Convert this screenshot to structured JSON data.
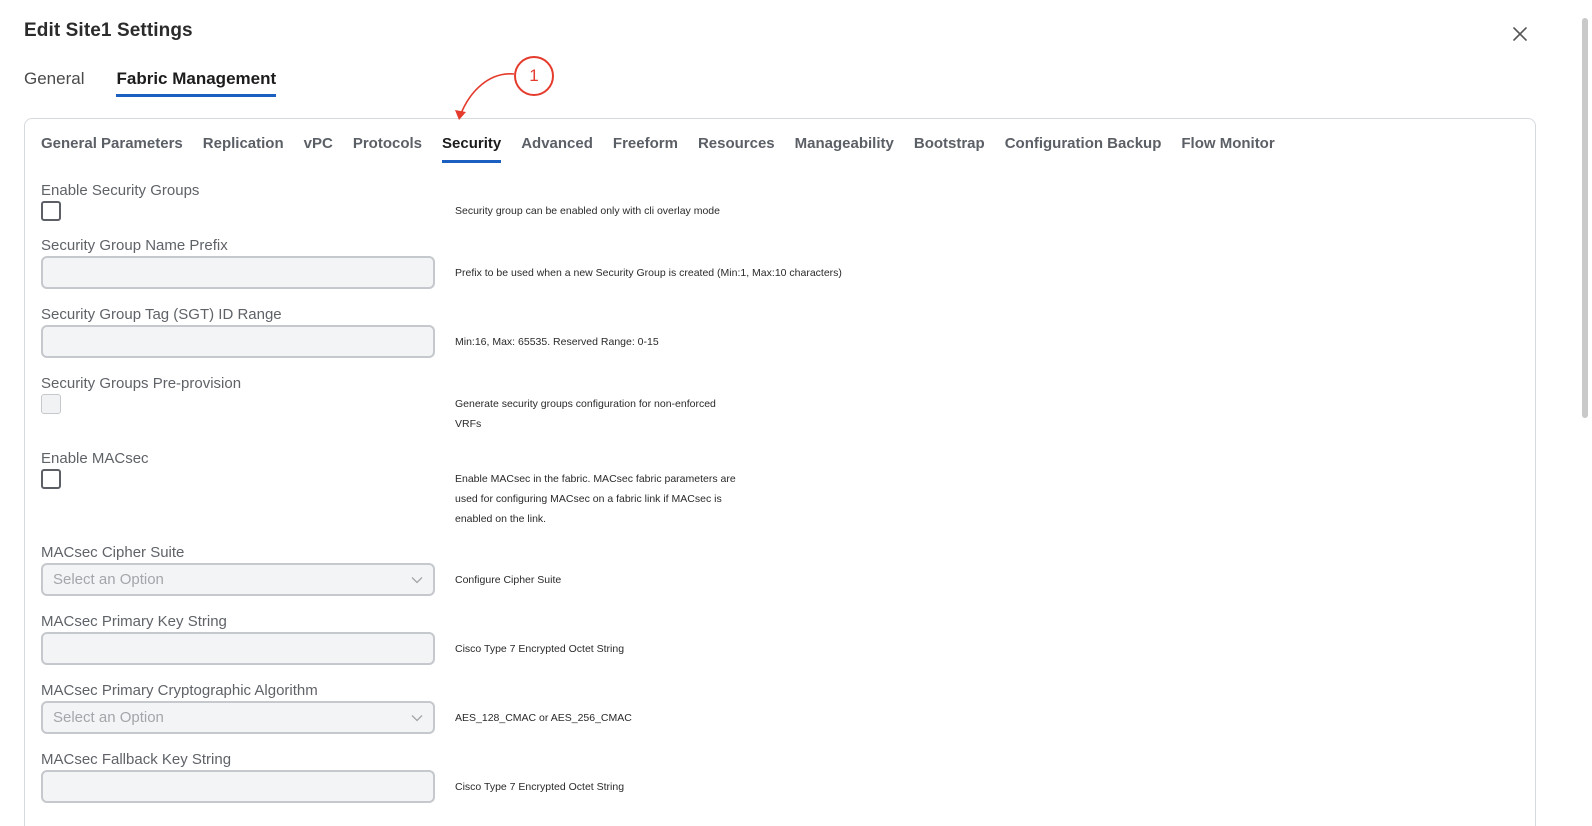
{
  "dialog": {
    "title": "Edit Site1 Settings"
  },
  "top_tabs": [
    {
      "label": "General",
      "active": false
    },
    {
      "label": "Fabric Management",
      "active": true
    }
  ],
  "sub_tabs": [
    {
      "label": "General Parameters"
    },
    {
      "label": "Replication"
    },
    {
      "label": "vPC"
    },
    {
      "label": "Protocols"
    },
    {
      "label": "Security",
      "active": true
    },
    {
      "label": "Advanced"
    },
    {
      "label": "Freeform"
    },
    {
      "label": "Resources"
    },
    {
      "label": "Manageability"
    },
    {
      "label": "Bootstrap"
    },
    {
      "label": "Configuration Backup"
    },
    {
      "label": "Flow Monitor"
    }
  ],
  "fields": {
    "enable_security_groups": {
      "label": "Enable Security Groups",
      "checked": false,
      "help": "Security group can be enabled only with cli overlay mode"
    },
    "sg_name_prefix": {
      "label": "Security Group Name Prefix",
      "value": "",
      "help": "Prefix to be used when a new Security Group is created (Min:1, Max:10 characters)"
    },
    "sgt_id_range": {
      "label": "Security Group Tag (SGT) ID Range",
      "value": "",
      "help": "Min:16, Max: 65535. Reserved Range: 0-15"
    },
    "sg_preprovision": {
      "label": "Security Groups Pre-provision",
      "checked": false,
      "disabled": true,
      "help_line1": "Generate security groups configuration for non-enforced",
      "help_line2": "VRFs"
    },
    "enable_macsec": {
      "label": "Enable MACsec",
      "checked": false,
      "help_line1": "Enable MACsec in the fabric. MACsec fabric parameters are",
      "help_line2": "used for configuring MACsec on a fabric link if MACsec is",
      "help_line3": "enabled on the link."
    },
    "macsec_cipher_suite": {
      "label": "MACsec Cipher Suite",
      "placeholder": "Select an Option",
      "help": "Configure Cipher Suite"
    },
    "macsec_primary_key": {
      "label": "MACsec Primary Key String",
      "value": "",
      "help": "Cisco Type 7 Encrypted Octet String"
    },
    "macsec_primary_algo": {
      "label": "MACsec Primary Cryptographic Algorithm",
      "placeholder": "Select an Option",
      "help": "AES_128_CMAC or AES_256_CMAC"
    },
    "macsec_fallback_key": {
      "label": "MACsec Fallback Key String",
      "value": "",
      "help": "Cisco Type 7 Encrypted Octet String"
    }
  },
  "annotation": {
    "number": "1",
    "color": "#e43b2c"
  },
  "colors": {
    "accent": "#1b5fc1"
  }
}
